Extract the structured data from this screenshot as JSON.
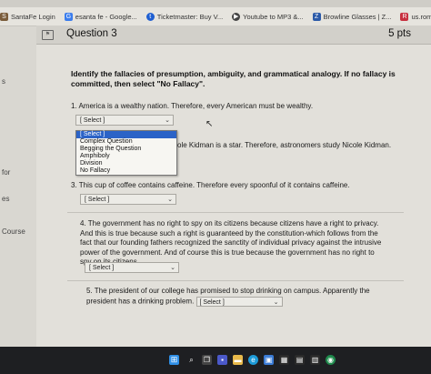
{
  "bookmarks": [
    {
      "label": "SantaFe Login",
      "icon": "sf-icon",
      "color": "#7a5c3a"
    },
    {
      "label": "esanta fe - Google...",
      "icon": "google-icon",
      "color": "#3b7ded"
    },
    {
      "label": "Ticketmaster: Buy V...",
      "icon": "ticketmaster-icon",
      "color": "#1f5fd1"
    },
    {
      "label": "Youtube to MP3 &...",
      "icon": "youtube-mp3-icon",
      "color": "#444444"
    },
    {
      "label": "Browline Glasses | Z...",
      "icon": "zenni-icon",
      "color": "#2b5aa8"
    },
    {
      "label": "us.romwe.com/Top...",
      "icon": "romwe-icon",
      "color": "#c7303f"
    }
  ],
  "sidebar": {
    "items": [
      "s",
      "for",
      "es",
      "Course"
    ]
  },
  "question": {
    "title": "Question 3",
    "points": "5 pts",
    "instructions": "Identify the fallacies of presumption, ambiguity, and grammatical analogy. If no fallacy is committed, then select \"No Fallacy\".",
    "items": [
      {
        "text": "1. America is a wealthy nation. Therefore, every American must be wealthy.",
        "select_value": "[ Select ]"
      },
      {
        "text": "ole Kidman is a star. Therefore, astronomers study Nicole Kidman."
      },
      {
        "text": "3. This cup of coffee contains caffeine. Therefore every spoonful of it contains caffeine.",
        "select_value": "[ Select ]"
      },
      {
        "text": "4. The government has no right to spy on its citizens because citizens have a right to privacy. And this is true because such a right is guaranteed by the constitution-which follows from the fact that our founding fathers recognized the sanctity of individual privacy against the intrusive power of the government. And of course this is true because the government has no right to spy on its citizens.",
        "select_value": "[ Select ]"
      },
      {
        "text": "5. The president of our college has promised to stop drinking on campus. Apparently the president has a drinking problem.",
        "select_value": "[ Select ]"
      }
    ],
    "dropdown_options": [
      "[ Select ]",
      "Complex Question",
      "Begging the Question",
      "Amphiboly",
      "Division",
      "No Fallacy"
    ]
  },
  "colors": {
    "selected_option": "#2b63c7",
    "taskbar": "#1e1f22"
  }
}
